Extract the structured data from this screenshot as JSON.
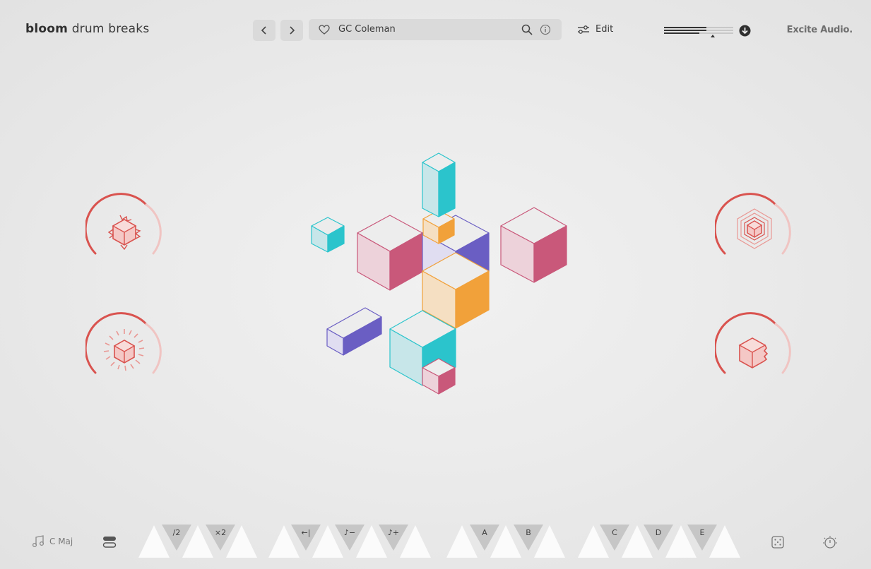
{
  "header": {
    "brand_bold": "bloom",
    "brand_rest": "drum breaks",
    "prev_icon": "chevron-left-icon",
    "next_icon": "chevron-right-icon",
    "favorite_icon": "heart-icon",
    "preset_name": "GC Coleman",
    "search_icon": "search-icon",
    "info_icon": "info-icon",
    "edit_label": "Edit",
    "edit_icon": "sliders-icon",
    "download_icon": "download-icon",
    "maker": "Excite Audio."
  },
  "knobs": [
    {
      "name": "knob-top-left",
      "icon": "spiky-cube-icon"
    },
    {
      "name": "knob-bottom-left",
      "icon": "burst-cube-icon"
    },
    {
      "name": "knob-top-right",
      "icon": "hexagon-cube-icon"
    },
    {
      "name": "knob-bottom-right",
      "icon": "rough-edge-cube-icon"
    }
  ],
  "footer": {
    "key_label": "C Maj",
    "key_icon": "music-note-icon",
    "layers_icon": "layers-icon",
    "pads": [
      "/2",
      "×2",
      "←|",
      "♪−",
      "♪+",
      "A",
      "B",
      "C",
      "D",
      "E"
    ],
    "dice_icon": "dice-icon",
    "timer_icon": "timer-icon"
  },
  "colors": {
    "accent_red": "#d9534f",
    "cyan": "#2bc4cc",
    "orange": "#f1a13a",
    "purple": "#6a5ec3",
    "pink": "#c9587a"
  }
}
